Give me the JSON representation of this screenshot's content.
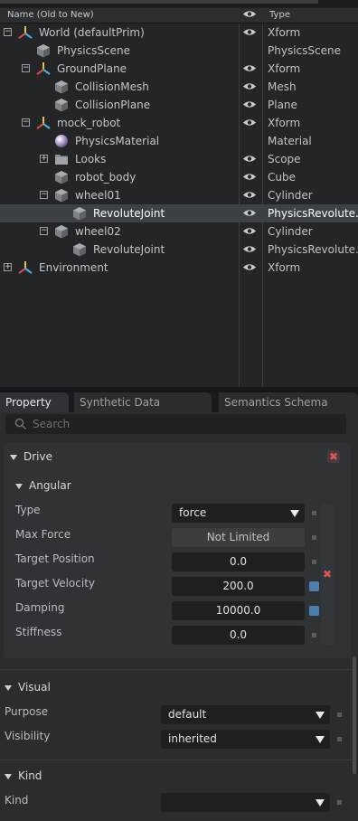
{
  "tree": {
    "header": {
      "name_col": "Name (Old to New)",
      "type_col": "Type"
    },
    "rows": [
      {
        "name": "World (defaultPrim)",
        "type": "Xform",
        "depth": 0,
        "expander": "minus",
        "icon": "xform-icon",
        "eye": true,
        "selected": false
      },
      {
        "name": "PhysicsScene",
        "type": "PhysicsScene",
        "depth": 1,
        "expander": "",
        "icon": "cube-icon",
        "eye": false,
        "selected": false
      },
      {
        "name": "GroundPlane",
        "type": "Xform",
        "depth": 1,
        "expander": "minus",
        "icon": "xform-icon",
        "eye": true,
        "selected": false
      },
      {
        "name": "CollisionMesh",
        "type": "Mesh",
        "depth": 2,
        "expander": "",
        "icon": "cube-icon",
        "eye": true,
        "selected": false
      },
      {
        "name": "CollisionPlane",
        "type": "Plane",
        "depth": 2,
        "expander": "",
        "icon": "cube-icon",
        "eye": true,
        "selected": false
      },
      {
        "name": "mock_robot",
        "type": "Xform",
        "depth": 1,
        "expander": "minus",
        "icon": "xform-icon",
        "eye": true,
        "selected": false
      },
      {
        "name": "PhysicsMaterial",
        "type": "Material",
        "depth": 2,
        "expander": "",
        "icon": "material-sphere-icon",
        "eye": false,
        "selected": false
      },
      {
        "name": "Looks",
        "type": "Scope",
        "depth": 2,
        "expander": "plus",
        "icon": "folder-icon",
        "eye": true,
        "selected": false
      },
      {
        "name": "robot_body",
        "type": "Cube",
        "depth": 2,
        "expander": "",
        "icon": "cube-icon",
        "eye": true,
        "selected": false
      },
      {
        "name": "wheel01",
        "type": "Cylinder",
        "depth": 2,
        "expander": "minus",
        "icon": "cube-icon",
        "eye": true,
        "selected": false
      },
      {
        "name": "RevoluteJoint",
        "type": "PhysicsRevolute...",
        "depth": 3,
        "expander": "",
        "icon": "cube-icon",
        "eye": true,
        "selected": true
      },
      {
        "name": "wheel02",
        "type": "Cylinder",
        "depth": 2,
        "expander": "minus",
        "icon": "cube-icon",
        "eye": true,
        "selected": false
      },
      {
        "name": "RevoluteJoint",
        "type": "PhysicsRevolute...",
        "depth": 3,
        "expander": "",
        "icon": "cube-icon",
        "eye": true,
        "selected": false
      },
      {
        "name": "Environment",
        "type": "Xform",
        "depth": 0,
        "expander": "plus",
        "icon": "xform-icon",
        "eye": true,
        "selected": false
      }
    ]
  },
  "tabs": [
    {
      "label": "Property",
      "active": true
    },
    {
      "label": "Synthetic Data Recorder",
      "active": false
    },
    {
      "label": "Semantics Schema Editor",
      "active": false
    }
  ],
  "search": {
    "placeholder": "Search"
  },
  "drive": {
    "title": "Drive",
    "angular": {
      "title": "Angular",
      "type_label": "Type",
      "type_value": "force",
      "max_force_label": "Max Force",
      "max_force_value": "Not Limited",
      "target_position_label": "Target Position",
      "target_position_value": "0.0",
      "target_velocity_label": "Target Velocity",
      "target_velocity_value": "200.0",
      "damping_label": "Damping",
      "damping_value": "10000.0",
      "stiffness_label": "Stiffness",
      "stiffness_value": "0.0"
    }
  },
  "visual": {
    "title": "Visual",
    "purpose_label": "Purpose",
    "purpose_value": "default",
    "visibility_label": "Visibility",
    "visibility_value": "inherited"
  },
  "kind": {
    "title": "Kind",
    "kind_label": "Kind",
    "kind_value": ""
  },
  "colors": {
    "selected_row": "#3c4146",
    "accent_blue": "#4a7fb0",
    "remove_red": "#e05656"
  }
}
